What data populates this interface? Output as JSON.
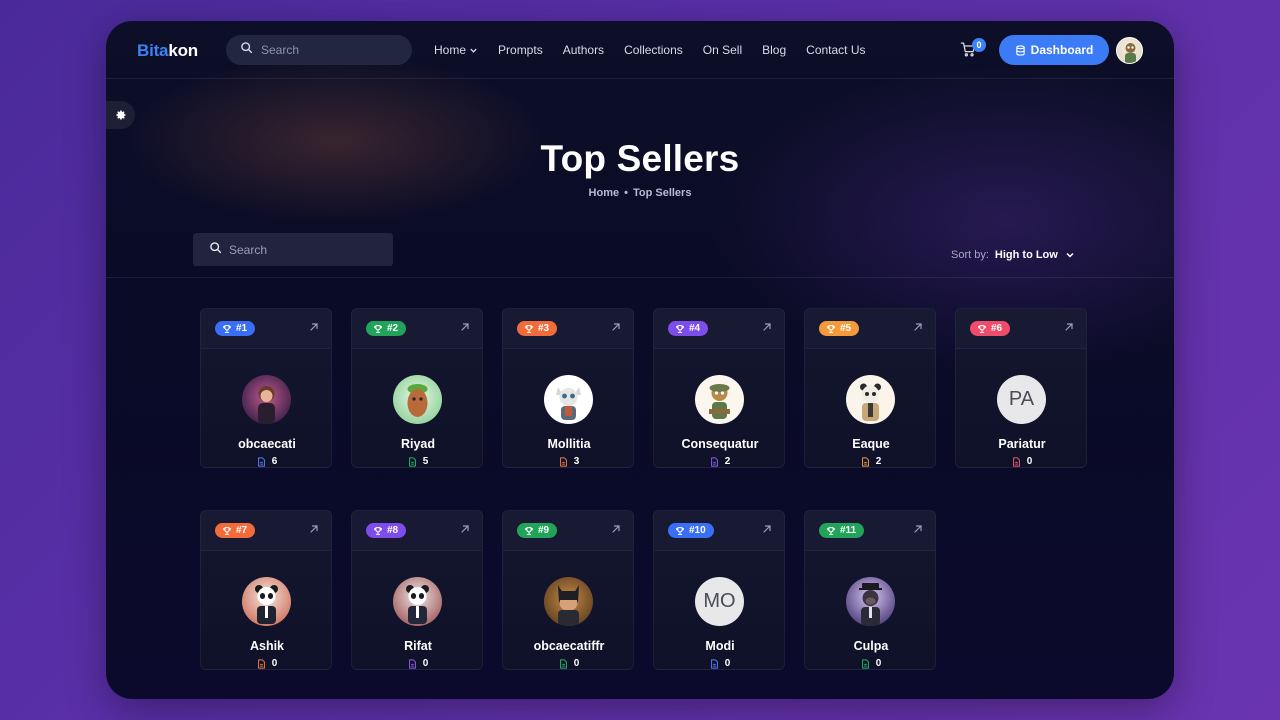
{
  "navbar": {
    "logo_part1": "Bita",
    "logo_part2": "kon",
    "search_placeholder": "Search",
    "menu": [
      "Home",
      "Prompts",
      "Authors",
      "Collections",
      "On Sell",
      "Blog",
      "Contact Us"
    ],
    "cart_count": "0",
    "dashboard_label": "Dashboard"
  },
  "hero": {
    "title": "Top Sellers",
    "breadcrumb": [
      "Home",
      "Top Sellers"
    ],
    "breadcrumb_separator": "•"
  },
  "filters": {
    "search_placeholder": "Search",
    "sort_label": "Sort by:",
    "sort_value": "High to Low"
  },
  "sellers": [
    {
      "rank": "#1",
      "name": "obcaecati",
      "count": "6",
      "rank_color": "#3b6ef6",
      "icon_color": "#5b7cf7",
      "avatar": "photo-pink"
    },
    {
      "rank": "#2",
      "name": "Riyad",
      "count": "5",
      "rank_color": "#22a35a",
      "icon_color": "#27b366",
      "avatar": "photo-green"
    },
    {
      "rank": "#3",
      "name": "Mollitia",
      "count": "3",
      "rank_color": "#f26b3a",
      "icon_color": "#f27a45",
      "avatar": "photo-white"
    },
    {
      "rank": "#4",
      "name": "Consequatur",
      "count": "2",
      "rank_color": "#7c4dea",
      "icon_color": "#8a5cf0",
      "avatar": "photo-cream"
    },
    {
      "rank": "#5",
      "name": "Eaque",
      "count": "2",
      "rank_color": "#f59a3b",
      "icon_color": "#f39a45",
      "avatar": "photo-cream2"
    },
    {
      "rank": "#6",
      "name": "Pariatur",
      "count": "0",
      "rank_color": "#ef4d6a",
      "icon_color": "#f0577a",
      "avatar": "PA"
    },
    {
      "rank": "#7",
      "name": "Ashik",
      "count": "0",
      "rank_color": "#f26b3a",
      "icon_color": "#f27a45",
      "avatar": "photo-panda-red"
    },
    {
      "rank": "#8",
      "name": "Rifat",
      "count": "0",
      "rank_color": "#7c4dea",
      "icon_color": "#8a5cf0",
      "avatar": "photo-panda"
    },
    {
      "rank": "#9",
      "name": "obcaecatiffr",
      "count": "0",
      "rank_color": "#22a35a",
      "icon_color": "#27b366",
      "avatar": "photo-bat"
    },
    {
      "rank": "#10",
      "name": "Modi",
      "count": "0",
      "rank_color": "#3b6ef6",
      "icon_color": "#5b7cf7",
      "avatar": "MO"
    },
    {
      "rank": "#11",
      "name": "Culpa",
      "count": "0",
      "rank_color": "#22a35a",
      "icon_color": "#27b366",
      "avatar": "photo-gorilla"
    }
  ],
  "colors": {
    "accent": "#3b7bf6",
    "background_outer": "#5a2fa8",
    "background_inner": "#0b0c27"
  }
}
